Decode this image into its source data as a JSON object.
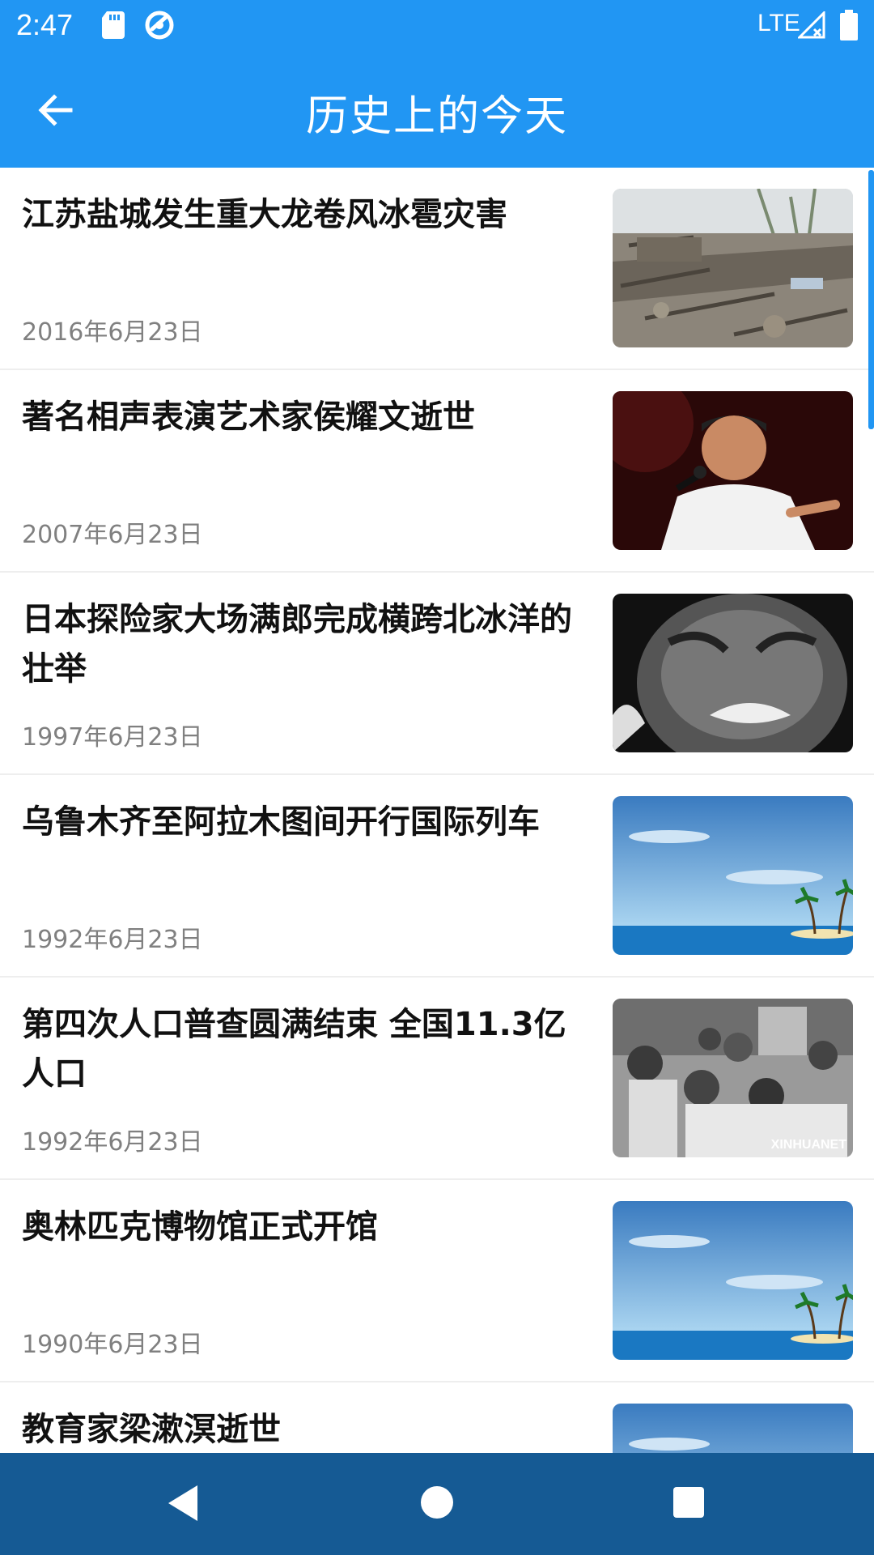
{
  "status_bar": {
    "time": "2:47",
    "network": "LTE",
    "icons": [
      "sd-card-icon",
      "sync-icon",
      "signal-icon",
      "battery-icon"
    ]
  },
  "app_bar": {
    "title": "历史上的今天",
    "back_icon": "arrow-back-icon"
  },
  "colors": {
    "primary": "#2196F3",
    "nav_bar": "#155A94",
    "date_text": "#808080"
  },
  "events": [
    {
      "title": "江苏盐城发生重大龙卷风冰雹灾害",
      "date": "2016年6月23日",
      "thumb": "tornado-debris-photo"
    },
    {
      "title": "著名相声表演艺术家侯耀文逝世",
      "date": "2007年6月23日",
      "thumb": "performer-with-microphone-photo"
    },
    {
      "title": "日本探险家大场满郎完成横跨北冰洋的壮举",
      "date": "1997年6月23日",
      "thumb": "frosted-face-photo"
    },
    {
      "title": "乌鲁木齐至阿拉木图间开行国际列车",
      "date": "1992年6月23日",
      "thumb": "island-placeholder-image"
    },
    {
      "title": "第四次人口普查圆满结束 全国11.3亿人口",
      "date": "1992年6月23日",
      "thumb": "census-photo",
      "watermark": "XINHUANET"
    },
    {
      "title": "奥林匹克博物馆正式开馆",
      "date": "1990年6月23日",
      "thumb": "island-placeholder-image"
    },
    {
      "title": "教育家梁漱溟逝世",
      "date": "",
      "thumb": "island-placeholder-image"
    }
  ],
  "nav_bar": {
    "buttons": [
      "nav-back-icon",
      "nav-home-icon",
      "nav-recents-icon"
    ]
  }
}
